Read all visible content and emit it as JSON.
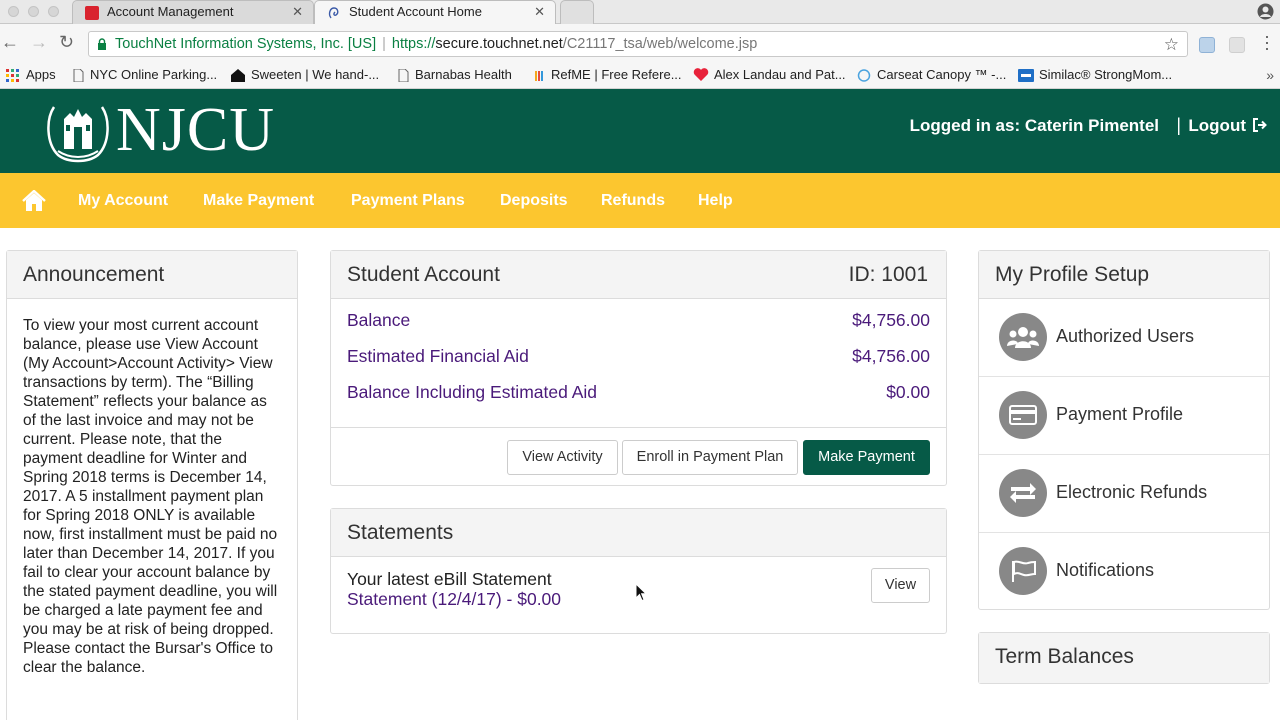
{
  "browser": {
    "tabs": [
      {
        "title": "Account Management",
        "active": false
      },
      {
        "title": "Student Account Home",
        "active": true
      }
    ],
    "address": {
      "org": "TouchNet Information Systems, Inc. [US]",
      "scheme": "https://",
      "host": "secure.touchnet.net",
      "path": "/C21117_tsa/web/welcome.jsp"
    },
    "bookmarks": [
      "Apps",
      "NYC Online Parking...",
      "Sweeten | We hand-...",
      "Barnabas Health",
      "RefME | Free Refere...",
      "Alex Landau and Pat...",
      "Carseat Canopy ™ -...",
      "Similac® StrongMom..."
    ]
  },
  "header": {
    "logo_text": "NJCU",
    "logged_in": "Logged in as: Caterin Pimentel",
    "separator": "|",
    "logout": "Logout"
  },
  "nav": {
    "items": [
      "My Account",
      "Make Payment",
      "Payment Plans",
      "Deposits",
      "Refunds",
      "Help"
    ]
  },
  "announcement": {
    "title": "Announcement",
    "body": "To view your most current account balance, please use View Account (My Account>Account Activity> View transactions by term). The “Billing Statement” reflects your balance as of the last invoice and may not be current. Please note, that the payment deadline for Winter and Spring 2018 terms is December 14, 2017. A 5 installment payment plan for Spring 2018 ONLY is available now, first installment must be paid no later than December 14, 2017. If you fail to clear your account balance by the stated payment deadline, you will be charged a late payment fee and you may be at risk of being dropped. Please contact the Bursar's Office to clear the balance."
  },
  "student_account": {
    "title": "Student Account",
    "id": "ID: 1001",
    "rows": [
      {
        "label": "Balance",
        "value": "$4,756.00"
      },
      {
        "label": "Estimated Financial Aid",
        "value": "$4,756.00"
      },
      {
        "label": "Balance Including Estimated Aid",
        "value": "$0.00"
      }
    ],
    "buttons": {
      "view_activity": "View Activity",
      "enroll": "Enroll in Payment Plan",
      "make_payment": "Make Payment"
    }
  },
  "statements": {
    "title": "Statements",
    "latest": "Your latest eBill Statement",
    "statement": "Statement (12/4/17) - $0.00",
    "view": "View"
  },
  "profile": {
    "title": "My Profile Setup",
    "items": [
      "Authorized Users",
      "Payment Profile",
      "Electronic Refunds",
      "Notifications"
    ]
  },
  "term_balances": {
    "title": "Term Balances"
  },
  "colors": {
    "header_green": "#065a47",
    "nav_gold": "#fcc62f",
    "link_purple": "#4a1a7a",
    "icon_gray": "#888888"
  }
}
